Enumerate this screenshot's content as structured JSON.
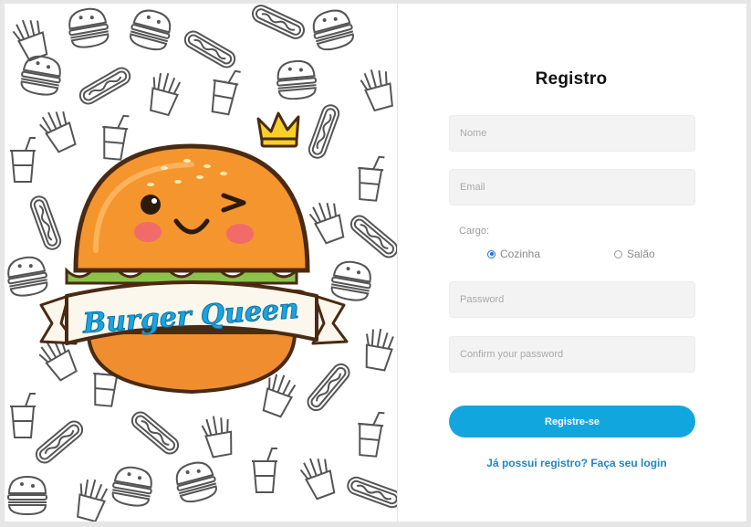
{
  "logo": {
    "text": "Burger Queen",
    "colors": {
      "bun": "#f08e2f",
      "lettuce": "#8cc24a",
      "banner": "#fbf7ec",
      "text": "#1aa4e0",
      "crown": "#f7d12a",
      "cheek": "#f26b6b"
    }
  },
  "form": {
    "title": "Registro",
    "name_placeholder": "Nome",
    "email_placeholder": "Email",
    "cargo_label": "Cargo:",
    "radio_options": [
      {
        "label": "Cozinha",
        "checked": true
      },
      {
        "label": "Salão",
        "checked": false
      }
    ],
    "password_placeholder": "Password",
    "confirm_placeholder": "Confirm your password",
    "submit_label": "Registre-se",
    "login_link": "Já possui registro? Faça seu login"
  },
  "colors": {
    "accent": "#12a6df",
    "link": "#1f86c7",
    "field_bg": "#f3f3f3"
  }
}
